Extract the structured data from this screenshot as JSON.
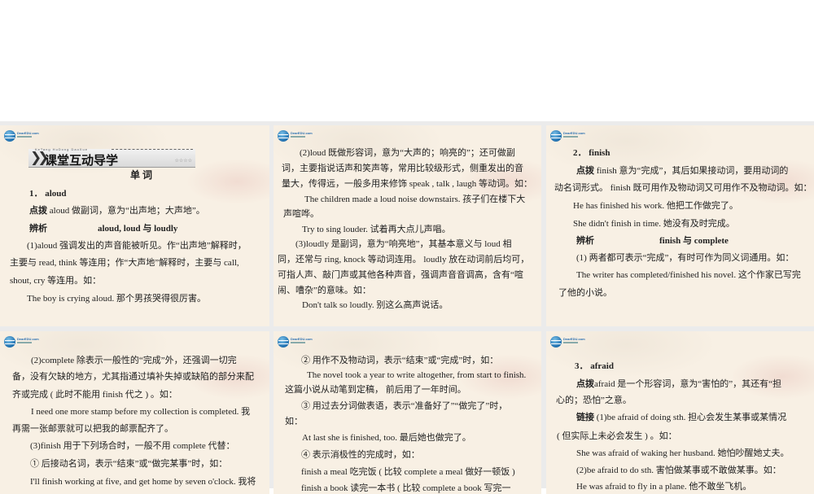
{
  "logo": {
    "brand": "DearEDU.com"
  },
  "slides": [
    {
      "banner": {
        "pinyin": "KeTang HuDong DaoXue",
        "title": "课堂互动导学",
        "stars": "☆☆☆☆"
      },
      "section": "单 词",
      "heading": "1．  aloud",
      "tip_label": "点拨",
      "tip": " aloud 做副词，意为“出声地；大声地”。",
      "compare_label": "辨析",
      "compare": "aloud, loud 与  loudly",
      "lines": [
        "(1)aloud 强调发出的声音能被听见。作“出声地”解释时，",
        "主要与  read, think 等连用；作“大声地”解释时，主要与  call,",
        "shout, cry 等连用。如：",
        "The boy is crying aloud. 那个男孩哭得很厉害。"
      ]
    },
    {
      "lines": [
        "(2)loud 既做形容词，意为“大声的；响亮的”；还可做副",
        "词，主要指说话声和笑声等，常用比较级形式，侧重发出的音",
        "量大，传得远，一般多用来修饰  speak , talk , laugh  等动词。如：",
        "The children made a loud noise downstairs. 孩子们在楼下大",
        "声喧哗。",
        "Try to sing louder. 试着再大点儿声唱。",
        "(3)loudly 是副词，意为“响亮地”，其基本意义与  loud  相",
        "同，还常与  ring, knock 等动词连用。 loudly 放在动词前后均可，",
        "可指人声、敲门声或其他各种声音，强调声音音调高，含有“喧",
        "闹、嘈杂”的意味。如：",
        "Don't talk so loudly. 别这么高声说话。"
      ]
    },
    {
      "heading": "2．  finish",
      "tip_label": "点拨",
      "compare_label": "辨析",
      "compare": "finish 与  complete",
      "lines": [
        " finish 意为“完成”，其后如果接动词，要用动词的",
        "动名词形式。 finish 既可用作及物动词又可用作不及物动词。如：",
        "He has finished his work. 他把工作做完了。",
        "She didn't finish in time. 她没有及时完成。",
        "(1) 两者都可表示“完成”，有时可作为同义词通用。如：",
        "The writer has completed/finished his novel. 这个作家已写完",
        "了他的小说。"
      ]
    },
    {
      "lines": [
        "(2)complete  除表示一般性的“完成”外，还强调一切完",
        "备，没有欠缺的地方，尤其指通过填补失掉或缺陷的部分来配",
        "齐或完成 ( 此时不能用  finish 代之 ) 。如：",
        "I need one more stamp before my collection is completed. 我",
        "再需一张邮票就可以把我的邮票配齐了。",
        "(3)finish 用于下列场合时，一般不用  complete 代替：",
        "① 后接动名词，表示“结束”或“做完某事”时，如：",
        "I'll finish working at five, and get home by seven o'clock. 我将"
      ]
    },
    {
      "lines": [
        "② 用作不及物动词，表示“结束”或“完成”时，如：",
        "The novel took a year to write altogether, from start to finish.",
        "这篇小说从动笔到定稿，  前后用了一年时间。",
        "③ 用过去分词做表语，表示“准备好了”“做完了”时，",
        "如：",
        "At last she is finished, too. 最后她也做完了。",
        "④ 表示消极性的完成时，如：",
        "finish a meal  吃完饭 ( 比较  complete a meal  做好一顿饭 )",
        "finish a book  读完一本书 ( 比较  complete a book  写完一"
      ]
    },
    {
      "heading": "3．  afraid",
      "tip_label": "点拨",
      "link_label": "链接",
      "lines": [
        "afraid 是一个形容词，意为“害怕的”，其还有“担",
        "心的；恐怕”之意。",
        "  (1)be afraid of doing sth. 担心会发生某事或某情况",
        "( 但实际上未必会发生 ) 。如：",
        "She was afraid of waking her husband. 她怕吵醒她丈夫。",
        "(2)be afraid to do sth. 害怕做某事或不敢做某事。如：",
        "He was afraid to fly in a plane. 他不敢坐飞机。"
      ]
    }
  ]
}
